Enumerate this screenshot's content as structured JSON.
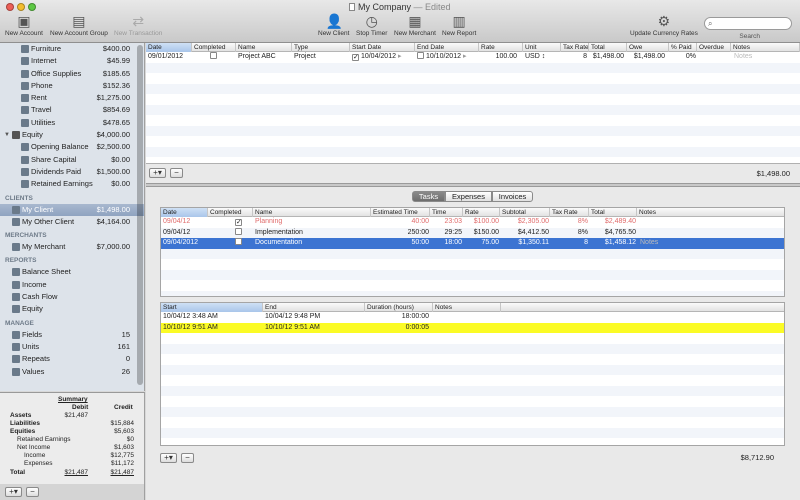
{
  "window": {
    "title": "My Company",
    "status": "— Edited"
  },
  "toolbar": {
    "new_account": "New Account",
    "new_account_group": "New Account Group",
    "new_transaction": "New Transaction",
    "new_client": "New Client",
    "stop_timer": "Stop Timer",
    "new_merchant": "New Merchant",
    "new_report": "New Report",
    "update_rates": "Update Currency Rates",
    "search_label": "Search",
    "search_placeholder": ""
  },
  "sidebar": {
    "accounts": [
      {
        "name": "Furniture",
        "value": "$400.00"
      },
      {
        "name": "Internet",
        "value": "$45.99"
      },
      {
        "name": "Office Supplies",
        "value": "$185.65"
      },
      {
        "name": "Phone",
        "value": "$152.36"
      },
      {
        "name": "Rent",
        "value": "$1,275.00"
      },
      {
        "name": "Travel",
        "value": "$854.69"
      },
      {
        "name": "Utilities",
        "value": "$478.65"
      }
    ],
    "equity_group": {
      "name": "Equity",
      "value": "$4,000.00"
    },
    "equity": [
      {
        "name": "Opening Balance",
        "value": "$2,500.00"
      },
      {
        "name": "Share Capital",
        "value": "$0.00"
      },
      {
        "name": "Dividends Paid",
        "value": "$1,500.00"
      },
      {
        "name": "Retained Earnings",
        "value": "$0.00"
      }
    ],
    "clients_header": "CLIENTS",
    "clients": [
      {
        "name": "My Client",
        "value": "$1,498.00"
      },
      {
        "name": "My Other Client",
        "value": "$4,164.00"
      }
    ],
    "merchants_header": "MERCHANTS",
    "merchants": [
      {
        "name": "My Merchant",
        "value": "$7,000.00"
      }
    ],
    "reports_header": "REPORTS",
    "reports": [
      {
        "name": "Balance Sheet"
      },
      {
        "name": "Income"
      },
      {
        "name": "Cash Flow"
      },
      {
        "name": "Equity"
      }
    ],
    "manage_header": "MANAGE",
    "manage": [
      {
        "name": "Fields",
        "value": "15"
      },
      {
        "name": "Units",
        "value": "161"
      },
      {
        "name": "Repeats",
        "value": "0"
      },
      {
        "name": "Values",
        "value": "26"
      }
    ]
  },
  "summary": {
    "title": "Summary",
    "debit": "Debit",
    "credit": "Credit",
    "assets": {
      "label": "Assets",
      "debit": "$21,487"
    },
    "liabilities": {
      "label": "Liabilities",
      "credit": "$15,884"
    },
    "equities": {
      "label": "Equities",
      "credit": "$5,603"
    },
    "retained": {
      "label": "Retained Earnings",
      "credit": "$0"
    },
    "net_income": {
      "label": "Net Income",
      "credit": "$1,603"
    },
    "income": {
      "label": "Income",
      "credit": "$12,775"
    },
    "expenses": {
      "label": "Expenses",
      "credit": "$11,172"
    },
    "total": {
      "label": "Total",
      "debit": "$21,487",
      "credit": "$21,487"
    }
  },
  "projects": {
    "headers": [
      "Date",
      "Completed",
      "Name",
      "Type",
      "Start Date",
      "End Date",
      "Rate",
      "Unit",
      "Tax Rate",
      "Total",
      "Owe",
      "% Paid",
      "Overdue",
      "Notes"
    ],
    "row": {
      "date": "09/01/2012",
      "name": "Project ABC",
      "type": "Project",
      "start": "10/04/2012",
      "end": "10/10/2012",
      "rate": "100.00",
      "unit": "USD",
      "tax": "8",
      "total": "$1,498.00",
      "owe": "$1,498.00",
      "paid": "0%",
      "notes": "Notes"
    },
    "footer_total": "$1,498.00"
  },
  "tabs": {
    "tasks": "Tasks",
    "expenses": "Expenses",
    "invoices": "Invoices"
  },
  "tasks": {
    "headers": [
      "Date",
      "Completed",
      "Name",
      "Estimated Time",
      "Time",
      "Rate",
      "Subtotal",
      "Tax Rate",
      "Total",
      "Notes"
    ],
    "rows": [
      {
        "date": "09/04/12",
        "name": "Planning",
        "est": "40:00",
        "time": "23:03",
        "rate": "$100.00",
        "sub": "$2,305.00",
        "tax": "8%",
        "total": "$2,489.40",
        "notes": ""
      },
      {
        "date": "09/04/12",
        "name": "Implementation",
        "est": "250:00",
        "time": "29:25",
        "rate": "$150.00",
        "sub": "$4,412.50",
        "tax": "8%",
        "total": "$4,765.50",
        "notes": ""
      },
      {
        "date": "09/04/2012",
        "name": "Documentation",
        "est": "50:00",
        "time": "18:00",
        "rate": "75.00",
        "sub": "$1,350.11",
        "tax": "8",
        "total": "$1,458.12",
        "notes": "Notes"
      }
    ]
  },
  "times": {
    "headers": [
      "Start",
      "End",
      "Duration (hours)",
      "Notes"
    ],
    "rows": [
      {
        "start": "10/04/12 3:48 AM",
        "end": "10/04/12 9:48 PM",
        "dur": "18:00:00"
      },
      {
        "start": "10/10/12 9:51 AM",
        "end": "10/10/12 9:51 AM",
        "dur": "0:00:05"
      }
    ],
    "footer_total": "$8,712.90"
  },
  "colors": {
    "selection": "#3c74d2",
    "running_timer": "#fbfb25",
    "completed_text": "#e06c6c"
  }
}
